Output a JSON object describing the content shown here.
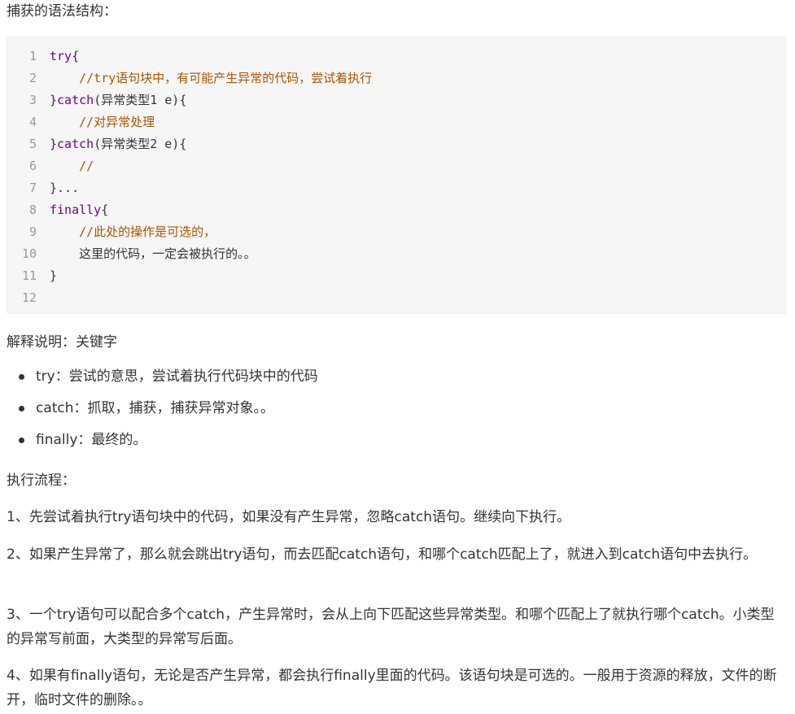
{
  "heading_syntax": "捕获的语法结构：",
  "code": {
    "line_numbers": [
      "1",
      "2",
      "3",
      "4",
      "5",
      "6",
      "7",
      "8",
      "9",
      "10",
      "11",
      "12"
    ],
    "lines": [
      {
        "pre": "",
        "kw": "try",
        "post": "{",
        "comment": ""
      },
      {
        "pre": "    ",
        "kw": "",
        "post": "",
        "comment": "//try语句块中，有可能产生异常的代码，尝试着执行"
      },
      {
        "pre": "}",
        "kw": "catch",
        "post": "(异常类型1 e){",
        "comment": ""
      },
      {
        "pre": "    ",
        "kw": "",
        "post": "",
        "comment": "//对异常处理"
      },
      {
        "pre": "}",
        "kw": "catch",
        "post": "(异常类型2 e){",
        "comment": ""
      },
      {
        "pre": "    ",
        "kw": "",
        "post": "",
        "comment": "//"
      },
      {
        "pre": "}...",
        "kw": "",
        "post": "",
        "comment": ""
      },
      {
        "pre": "",
        "kw": "finally",
        "post": "{",
        "comment": ""
      },
      {
        "pre": "    ",
        "kw": "",
        "post": "",
        "comment": "//此处的操作是可选的，"
      },
      {
        "pre": "    这里的代码，一定会被执行的。。",
        "kw": "",
        "post": "",
        "comment": ""
      },
      {
        "pre": "}",
        "kw": "",
        "post": "",
        "comment": ""
      },
      {
        "pre": "",
        "kw": "",
        "post": "",
        "comment": ""
      }
    ]
  },
  "heading_explain": "解释说明：关键字",
  "bullets": [
    "try：尝试的意思，尝试着执行代码块中的代码",
    "catch：抓取，捕获，捕获异常对象。。",
    "finally：最终的。"
  ],
  "heading_flow": "执行流程：",
  "flow": [
    "1、先尝试着执行try语句块中的代码，如果没有产生异常，忽略catch语句。继续向下执行。",
    "2、如果产生异常了，那么就会跳出try语句，而去匹配catch语句，和哪个catch匹配上了，就进入到catch语句中去执行。",
    "3、一个try语句可以配合多个catch，产生异常时，会从上向下匹配这些异常类型。和哪个匹配上了就执行哪个catch。小类型的异常写前面，大类型的异常写后面。",
    "4、如果有finally语句，无论是否产生异常，都会执行finally里面的代码。该语句块是可选的。一般用于资源的释放，文件的断开，临时文件的删除。。"
  ],
  "colors": {
    "text": "#333333",
    "keyword": "#770088",
    "comment": "#aa5500",
    "line_number": "#999999",
    "code_bg": "#f6f6f6"
  }
}
